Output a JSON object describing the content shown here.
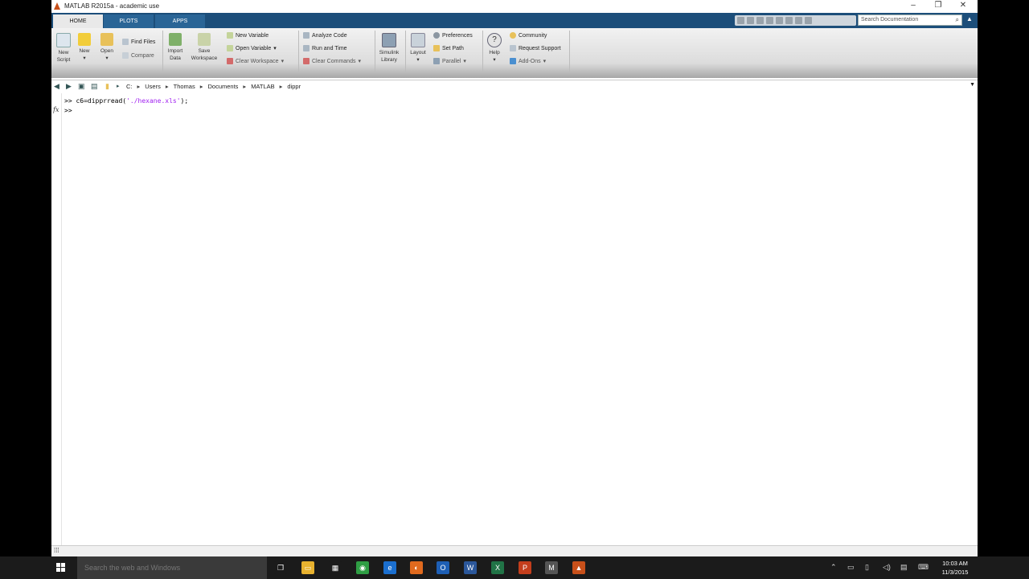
{
  "window": {
    "title": "MATLAB R2015a - academic use"
  },
  "tabs": [
    {
      "label": "HOME",
      "active": true
    },
    {
      "label": "PLOTS",
      "active": false
    },
    {
      "label": "APPS",
      "active": false
    }
  ],
  "search_doc": {
    "placeholder": "Search Documentation"
  },
  "ribbon": {
    "file": {
      "new_script": [
        "New",
        "Script"
      ],
      "new": "New",
      "open": "Open",
      "find_files": "Find Files",
      "compare": "Compare"
    },
    "variable": {
      "import_data": [
        "Import",
        "Data"
      ],
      "save_workspace": [
        "Save",
        "Workspace"
      ],
      "new_variable": "New Variable",
      "open_variable": "Open Variable",
      "clear_workspace": "Clear Workspace"
    },
    "code": {
      "analyze_code": "Analyze Code",
      "run_and_time": "Run and Time",
      "clear_commands": "Clear Commands"
    },
    "simulink": {
      "library": [
        "Simulink",
        "Library"
      ]
    },
    "environment": {
      "layout": "Layout",
      "preferences": "Preferences",
      "set_path": "Set Path",
      "parallel": "Parallel"
    },
    "resources": {
      "help": "Help",
      "community": "Community",
      "request_support": "Request Support",
      "add_ons": "Add-Ons"
    }
  },
  "address": {
    "crumbs": [
      "C:",
      "Users",
      "Thomas",
      "Documents",
      "MATLAB",
      "dippr"
    ]
  },
  "command_window": {
    "prompt": ">>",
    "line1_code": "c6=dipprread(",
    "line1_string": "'./hexane.xls'",
    "line1_end": ");",
    "fx": "fx"
  },
  "taskbar": {
    "search_placeholder": "Search the web and Windows",
    "time": "10:03 AM",
    "date": "11/3/2015",
    "apps": [
      {
        "name": "task-view",
        "color": "#1b1b1b",
        "glyph": "❐"
      },
      {
        "name": "file-explorer",
        "color": "#e8b22f",
        "glyph": "▭"
      },
      {
        "name": "calculator",
        "color": "#1b1b1b",
        "glyph": "▦"
      },
      {
        "name": "chrome",
        "color": "#2f9e44",
        "glyph": "◉"
      },
      {
        "name": "edge",
        "color": "#1b6fcf",
        "glyph": "e"
      },
      {
        "name": "firefox",
        "color": "#e06a1e",
        "glyph": "◐"
      },
      {
        "name": "outlook",
        "color": "#1e5fb5",
        "glyph": "O"
      },
      {
        "name": "word",
        "color": "#2b579a",
        "glyph": "W"
      },
      {
        "name": "excel",
        "color": "#217346",
        "glyph": "X"
      },
      {
        "name": "powerpoint",
        "color": "#c43e1c",
        "glyph": "P"
      },
      {
        "name": "mathcad",
        "color": "#555555",
        "glyph": "M"
      },
      {
        "name": "matlab",
        "color": "#c8501a",
        "glyph": "▲"
      }
    ]
  }
}
